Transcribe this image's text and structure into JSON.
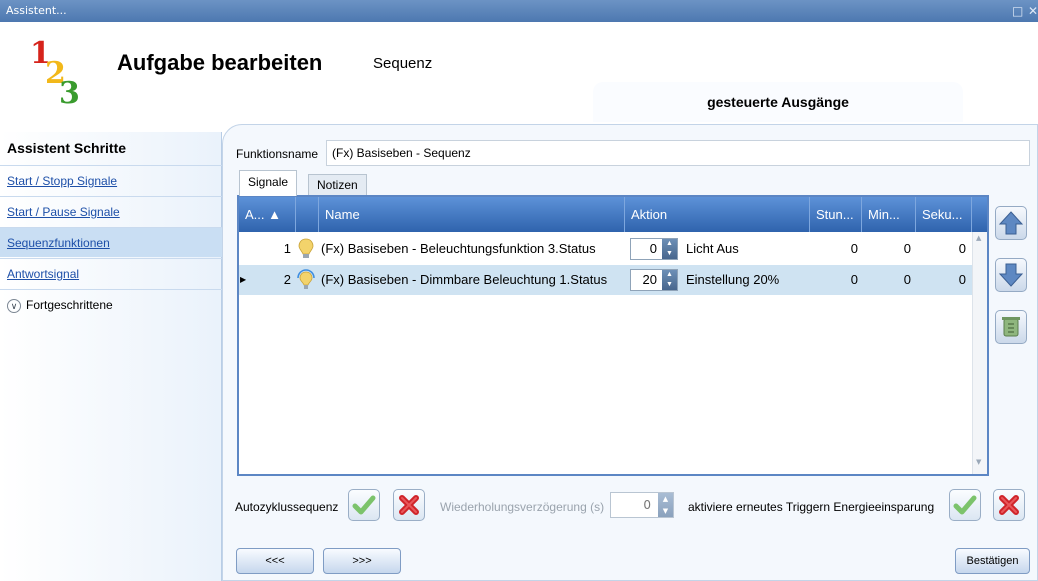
{
  "window": {
    "title": "Assistent...",
    "controls": [
      "□",
      "✕"
    ]
  },
  "header": {
    "logo": [
      "1",
      "2",
      "3"
    ],
    "title": "Aufgabe bearbeiten",
    "subtitle": "Sequenz",
    "section_tab": "gesteuerte Ausgänge"
  },
  "sidebar": {
    "title": "Assistent Schritte",
    "items": [
      {
        "label": "Start / Stopp Signale",
        "active": false
      },
      {
        "label": "Start / Pause Signale",
        "active": false
      },
      {
        "label": "Sequenzfunktionen",
        "active": true
      },
      {
        "label": "Antwortsignal",
        "active": false
      }
    ],
    "advanced": {
      "icon": "chevron-down-icon",
      "label": "Fortgeschrittene"
    }
  },
  "form": {
    "function_name_label": "Funktionsname",
    "function_name_value": "(Fx) Basiseben - Sequenz"
  },
  "tabs": [
    {
      "label": "Signale",
      "active": true
    },
    {
      "label": "Notizen",
      "active": false
    }
  ],
  "grid": {
    "columns": [
      "A... ▲",
      "",
      "Name",
      "Aktion",
      "Stun...",
      "Min...",
      "Seku..."
    ],
    "rows": [
      {
        "order": "1",
        "icon": "lightbulb-icon",
        "name": "(Fx) Basiseben - Beleuchtungsfunktion 3.Status",
        "value": "0",
        "action": "Licht Aus",
        "hours": "0",
        "minutes": "0",
        "seconds": "0",
        "selected": false
      },
      {
        "order": "2",
        "icon": "dimmable-lightbulb-icon",
        "name": "(Fx) Basiseben - Dimmbare Beleuchtung 1.Status",
        "value": "20",
        "action": "Einstellung 20%",
        "hours": "0",
        "minutes": "0",
        "seconds": "0",
        "selected": true
      }
    ]
  },
  "side_buttons": [
    "move-up-icon",
    "move-down-icon",
    "delete-icon"
  ],
  "bottom": {
    "autocycle_label": "Autozyklussequenz",
    "repeat_delay_label": "Wiederholungsverzögerung (s)",
    "repeat_delay_value": "0",
    "retrigger_label": "aktiviere erneutes Triggern Energieeinsparung"
  },
  "nav": {
    "back": "<<<",
    "forward": ">>>",
    "confirm": "Bestätigen"
  },
  "colors": {
    "accent": "#2f63ad",
    "header_blue": "#5d92d8",
    "selected_row": "#cfe3f2",
    "link": "#1d4fa8"
  }
}
